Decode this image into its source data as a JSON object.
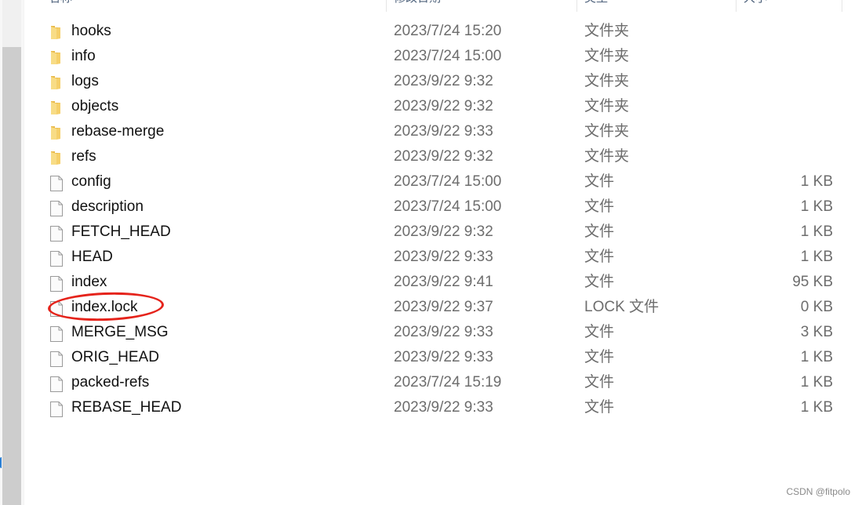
{
  "header": {
    "columns": [
      {
        "key": "name",
        "label": "名称"
      },
      {
        "key": "date",
        "label": "修改日期"
      },
      {
        "key": "type",
        "label": "类型"
      },
      {
        "key": "size",
        "label": "大小"
      }
    ]
  },
  "files": [
    {
      "name": "hooks",
      "date": "2023/7/24 15:20",
      "type": "文件夹",
      "size": "",
      "icon": "folder-icon"
    },
    {
      "name": "info",
      "date": "2023/7/24 15:00",
      "type": "文件夹",
      "size": "",
      "icon": "folder-icon"
    },
    {
      "name": "logs",
      "date": "2023/9/22 9:32",
      "type": "文件夹",
      "size": "",
      "icon": "folder-icon"
    },
    {
      "name": "objects",
      "date": "2023/9/22 9:32",
      "type": "文件夹",
      "size": "",
      "icon": "folder-icon"
    },
    {
      "name": "rebase-merge",
      "date": "2023/9/22 9:33",
      "type": "文件夹",
      "size": "",
      "icon": "folder-icon"
    },
    {
      "name": "refs",
      "date": "2023/9/22 9:32",
      "type": "文件夹",
      "size": "",
      "icon": "folder-icon"
    },
    {
      "name": "config",
      "date": "2023/7/24 15:00",
      "type": "文件",
      "size": "1 KB",
      "icon": "file-icon"
    },
    {
      "name": "description",
      "date": "2023/7/24 15:00",
      "type": "文件",
      "size": "1 KB",
      "icon": "file-icon"
    },
    {
      "name": "FETCH_HEAD",
      "date": "2023/9/22 9:32",
      "type": "文件",
      "size": "1 KB",
      "icon": "file-icon"
    },
    {
      "name": "HEAD",
      "date": "2023/9/22 9:33",
      "type": "文件",
      "size": "1 KB",
      "icon": "file-icon"
    },
    {
      "name": "index",
      "date": "2023/9/22 9:41",
      "type": "文件",
      "size": "95 KB",
      "icon": "file-icon"
    },
    {
      "name": "index.lock",
      "date": "2023/9/22 9:37",
      "type": "LOCK 文件",
      "size": "0 KB",
      "icon": "file-icon",
      "highlighted": true
    },
    {
      "name": "MERGE_MSG",
      "date": "2023/9/22 9:33",
      "type": "文件",
      "size": "3 KB",
      "icon": "file-icon"
    },
    {
      "name": "ORIG_HEAD",
      "date": "2023/9/22 9:33",
      "type": "文件",
      "size": "1 KB",
      "icon": "file-icon"
    },
    {
      "name": "packed-refs",
      "date": "2023/7/24 15:19",
      "type": "文件",
      "size": "1 KB",
      "icon": "file-icon"
    },
    {
      "name": "REBASE_HEAD",
      "date": "2023/9/22 9:33",
      "type": "文件",
      "size": "1 KB",
      "icon": "file-icon"
    }
  ],
  "colors": {
    "annotation": "#e5231b",
    "folder": "#f5cf6a",
    "header_text": "#4c607a"
  },
  "watermark": "CSDN @fitpolo"
}
